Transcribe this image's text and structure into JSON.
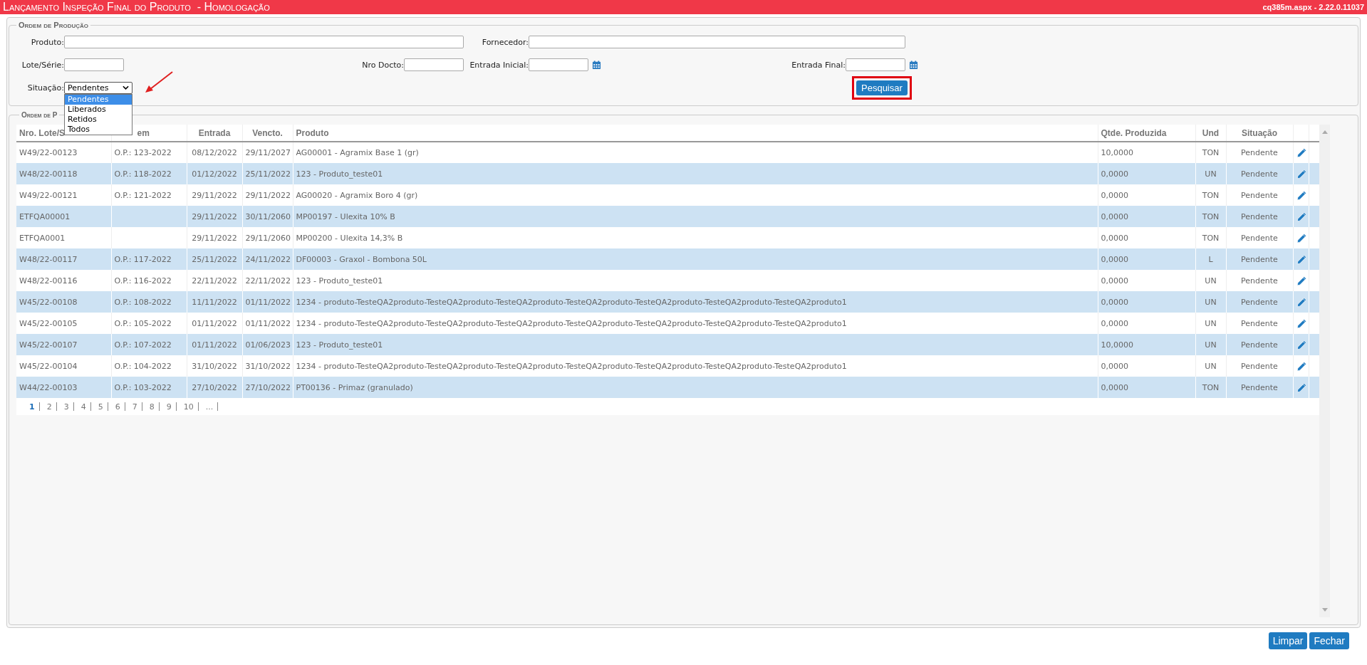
{
  "window": {
    "title": "Lançamento Inspeção Final do Produto  - Homologação",
    "page_info": "cq385m.aspx - 2.22.0.11037"
  },
  "filter": {
    "legend": "Ordem de Produção",
    "produto": {
      "label": "Produto:"
    },
    "fornecedor": {
      "label": "Fornecedor:"
    },
    "lote": {
      "label": "Lote/Série:"
    },
    "nro_docto": {
      "label": "Nro Docto:"
    },
    "entrada_inicial": {
      "label": "Entrada Inicial:"
    },
    "entrada_final": {
      "label": "Entrada Final:"
    },
    "situacao": {
      "label": "Situação:",
      "value": "Pendentes",
      "expanded": true,
      "options": [
        {
          "label": "Pendentes",
          "selected": true
        },
        {
          "label": "Liberados",
          "selected": false
        },
        {
          "label": "Retidos",
          "selected": false
        },
        {
          "label": "Todos",
          "selected": false
        }
      ]
    },
    "search_button": "Pesquisar"
  },
  "results": {
    "legend": "Ordem de P",
    "columns": [
      "Nro. Lote/S",
      "em",
      "Entrada",
      "Vencto.",
      "Produto",
      "Qtde. Produzida",
      "Und",
      "Situação"
    ],
    "rows": [
      [
        "W49/22-00123",
        "O.P.: 123-2022",
        "08/12/2022",
        "29/11/2027",
        "AG00001 - Agramix Base 1 (gr)",
        "10,0000",
        "TON",
        "Pendente"
      ],
      [
        "W48/22-00118",
        "O.P.: 118-2022",
        "01/12/2022",
        "25/11/2022",
        "123 - Produto_teste01",
        "0,0000",
        "UN",
        "Pendente"
      ],
      [
        "W49/22-00121",
        "O.P.: 121-2022",
        "29/11/2022",
        "29/11/2022",
        "AG00020 - Agramix Boro 4 (gr)",
        "0,0000",
        "TON",
        "Pendente"
      ],
      [
        "ETFQA00001",
        "",
        "29/11/2022",
        "30/11/2060",
        "MP00197 - Ulexita 10% B",
        "0,0000",
        "TON",
        "Pendente"
      ],
      [
        "ETFQA0001",
        "",
        "29/11/2022",
        "29/11/2060",
        "MP00200 - Ulexita 14,3% B",
        "0,0000",
        "TON",
        "Pendente"
      ],
      [
        "W48/22-00117",
        "O.P.: 117-2022",
        "25/11/2022",
        "24/11/2022",
        "DF00003 - Graxol - Bombona 50L",
        "0,0000",
        "L",
        "Pendente"
      ],
      [
        "W48/22-00116",
        "O.P.: 116-2022",
        "22/11/2022",
        "22/11/2022",
        "123 - Produto_teste01",
        "0,0000",
        "UN",
        "Pendente"
      ],
      [
        "W45/22-00108",
        "O.P.: 108-2022",
        "11/11/2022",
        "01/11/2022",
        "1234 - produto-TesteQA2produto-TesteQA2produto-TesteQA2produto-TesteQA2produto-TesteQA2produto-TesteQA2produto-TesteQA2produto1",
        "0,0000",
        "UN",
        "Pendente"
      ],
      [
        "W45/22-00105",
        "O.P.: 105-2022",
        "01/11/2022",
        "01/11/2022",
        "1234 - produto-TesteQA2produto-TesteQA2produto-TesteQA2produto-TesteQA2produto-TesteQA2produto-TesteQA2produto-TesteQA2produto1",
        "0,0000",
        "UN",
        "Pendente"
      ],
      [
        "W45/22-00107",
        "O.P.: 107-2022",
        "01/11/2022",
        "01/06/2023",
        "123 - Produto_teste01",
        "10,0000",
        "UN",
        "Pendente"
      ],
      [
        "W45/22-00104",
        "O.P.: 104-2022",
        "31/10/2022",
        "31/10/2022",
        "1234 - produto-TesteQA2produto-TesteQA2produto-TesteQA2produto-TesteQA2produto-TesteQA2produto-TesteQA2produto-TesteQA2produto1",
        "0,0000",
        "UN",
        "Pendente"
      ],
      [
        "W44/22-00103",
        "O.P.: 103-2022",
        "27/10/2022",
        "27/10/2022",
        "PT00136 - Primaz (granulado)",
        "0,0000",
        "TON",
        "Pendente"
      ]
    ],
    "pages": [
      {
        "label": "1",
        "selected": true
      },
      {
        "label": "2",
        "selected": false
      },
      {
        "label": "3",
        "selected": false
      },
      {
        "label": "4",
        "selected": false
      },
      {
        "label": "5",
        "selected": false
      },
      {
        "label": "6",
        "selected": false
      },
      {
        "label": "7",
        "selected": false
      },
      {
        "label": "8",
        "selected": false
      },
      {
        "label": "9",
        "selected": false
      },
      {
        "label": "10",
        "selected": false
      },
      {
        "label": "...",
        "selected": false
      }
    ]
  },
  "buttons": [
    "Limpar",
    "Fechar"
  ]
}
